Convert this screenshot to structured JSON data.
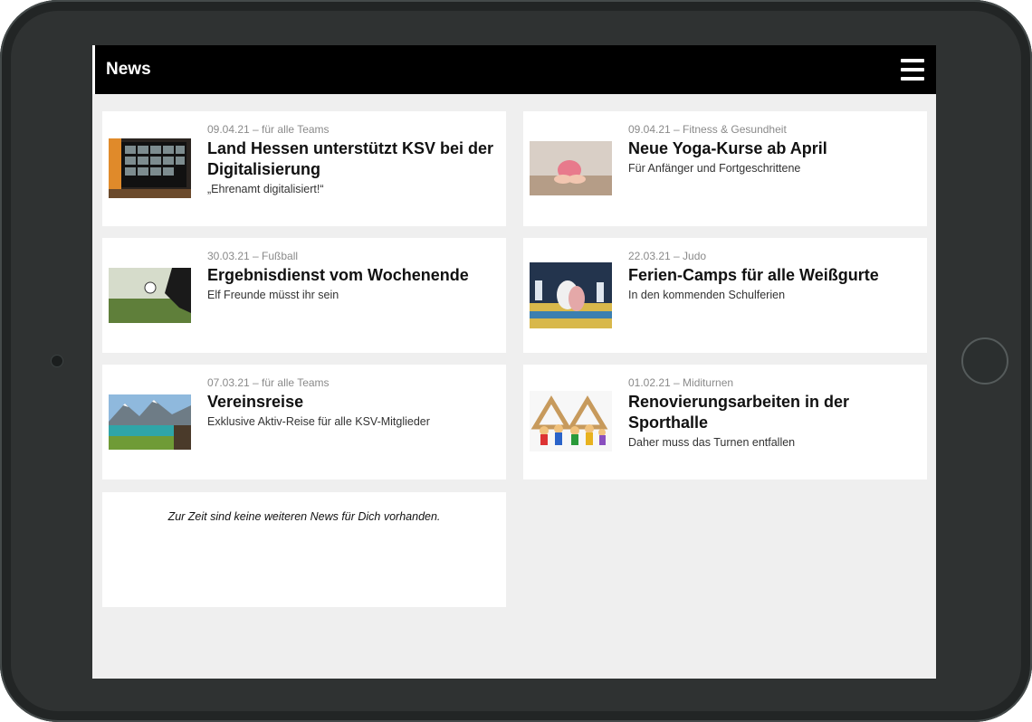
{
  "header": {
    "title": "News",
    "menu_icon": "hamburger-menu-icon"
  },
  "news": [
    {
      "meta": "09.04.21 – für alle Teams",
      "title": "Land Hessen unterstützt KSV bei der Digitalisierung",
      "subtitle": "„Ehrenamt digitalisiert!“",
      "image": "video-conference-image"
    },
    {
      "meta": "09.04.21 – Fitness & Gesundheit",
      "title": "Neue Yoga-Kurse ab April",
      "subtitle": "Für Anfänger und Fortgeschrittene",
      "image": "yoga-pose-image"
    },
    {
      "meta": "30.03.21 – Fußball",
      "title": "Ergebnisdienst vom Wochenende",
      "subtitle": "Elf Freunde müsst ihr sein",
      "image": "football-kick-image"
    },
    {
      "meta": "22.03.21 – Judo",
      "title": "Ferien-Camps für alle Weißgurte",
      "subtitle": "In den kommenden Schulferien",
      "image": "judo-match-image"
    },
    {
      "meta": "07.03.21 – für alle Teams",
      "title": "Vereinsreise",
      "subtitle": "Exklusive Aktiv-Reise für alle KSV-Mitglieder",
      "image": "mountain-lake-image"
    },
    {
      "meta": "01.02.21 – Miditurnen",
      "title": "Renovierungsarbeiten in der Sporthalle",
      "subtitle": "Daher muss das Turnen entfallen",
      "image": "toy-figures-image"
    }
  ],
  "empty_message": "Zur Zeit sind keine weiteren News für Dich vorhanden."
}
